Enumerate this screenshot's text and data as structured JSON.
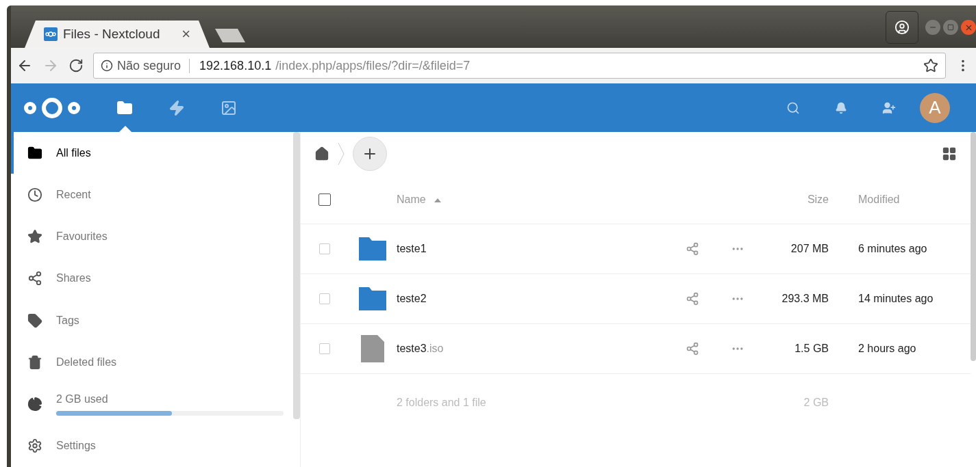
{
  "browser": {
    "tab": {
      "title": "Files - Nextcloud",
      "close": "×"
    },
    "address": {
      "security": "Não seguro",
      "host": "192.168.10.1",
      "path": "/index.php/apps/files/?dir=/&fileid=7"
    }
  },
  "header": {
    "apps": [
      {
        "kind": "files",
        "selected": true
      },
      {
        "kind": "activity",
        "selected": false
      },
      {
        "kind": "gallery",
        "selected": false
      }
    ],
    "avatar": "A"
  },
  "sidebar": {
    "items": [
      {
        "kind": "link",
        "label": "All files",
        "selected": true
      },
      {
        "kind": "link",
        "label": "Recent",
        "selected": false
      },
      {
        "kind": "link",
        "label": "Favourites",
        "selected": false
      },
      {
        "kind": "link",
        "label": "Shares",
        "selected": false
      },
      {
        "kind": "link",
        "label": "Tags",
        "selected": false
      },
      {
        "kind": "link",
        "label": "Deleted files",
        "selected": false
      },
      {
        "kind": "quota",
        "label": "2 GB used",
        "level": 0.51
      },
      {
        "kind": "link",
        "label": "Settings",
        "selected": false
      }
    ]
  },
  "table": {
    "columns": [
      "Name",
      "Size",
      "Modified"
    ],
    "select_all": {
      "checked": false
    },
    "rows": [
      {
        "kind": "folder",
        "name": "teste1",
        "size": "207 MB",
        "modified": "6 minutes ago",
        "checked": false
      },
      {
        "kind": "folder",
        "name": "teste2",
        "size": "293.3 MB",
        "modified": "14 minutes ago",
        "checked": false
      },
      {
        "kind": "file",
        "name": "teste3",
        "extension": ".iso",
        "size": "1.5 GB",
        "modified": "2 hours ago",
        "checked": false
      }
    ],
    "summary": {
      "text": "2 folders and 1 file",
      "size": "2 GB"
    }
  }
}
